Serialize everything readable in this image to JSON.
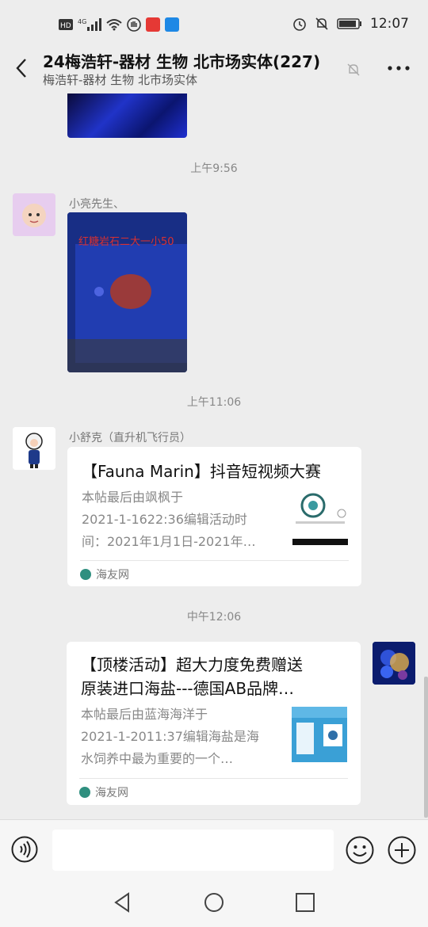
{
  "status_bar": {
    "left_icons": [
      "hd-icon",
      "4g-signal-icon",
      "wifi-icon",
      "hand-app-icon",
      "red-app-icon",
      "blue-app-icon"
    ],
    "right_icons": [
      "alarm-icon",
      "notifications-off-icon",
      "battery-icon"
    ],
    "time": "12:07"
  },
  "header": {
    "title": "24梅浩轩-器材 生物 北市场实体(227)",
    "subtitle": "梅浩轩-器材 生物 北市场实体"
  },
  "chat": {
    "timestamps": [
      "上午9:56",
      "上午11:06",
      "中午12:06"
    ],
    "messages": [
      {
        "sender": "小亮先生、",
        "type": "image",
        "image_caption": "红糖岩石二大一小50"
      },
      {
        "sender": "小舒克（直升机飞行员）",
        "type": "link_card",
        "title": "【Fauna Marin】抖音短视频大赛",
        "description_lines": [
          "本帖最后由飒枫于",
          "2021-1-1622:36编辑活动时",
          "间：2021年1月1日-2021年…"
        ],
        "source": "海友网"
      },
      {
        "sender": "self",
        "type": "link_card",
        "title_lines": [
          "【顶楼活动】超大力度免费赠送",
          "原装进口海盐---德国AB品牌…"
        ],
        "description_lines": [
          "本帖最后由蓝海海洋于",
          "2021-1-2011:37编辑海盐是海",
          "水饲养中最为重要的一个…"
        ],
        "source": "海友网"
      }
    ]
  },
  "input_bar": {
    "placeholder": ""
  },
  "colors": {
    "background": "#ededed",
    "card": "#ffffff",
    "accent_source": "#2f8f7f"
  }
}
